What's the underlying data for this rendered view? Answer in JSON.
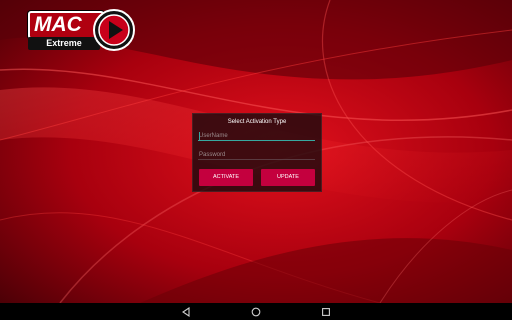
{
  "app": {
    "logo": {
      "brand": "MAC",
      "tagline": "Extreme"
    }
  },
  "dialog": {
    "title": "Select Activation Type",
    "username": {
      "value": "",
      "placeholder": "UserName"
    },
    "password": {
      "value": "",
      "placeholder": "Password"
    },
    "buttons": {
      "activate": "ACTIVATE",
      "update": "UPDATE"
    }
  },
  "navbar": {
    "back_icon": "back-triangle-icon",
    "home_icon": "home-circle-icon",
    "recent_icon": "recent-square-icon"
  },
  "colors": {
    "accent": "#c4003e",
    "focus_line": "#38a8a0",
    "background": "#9e0010"
  }
}
